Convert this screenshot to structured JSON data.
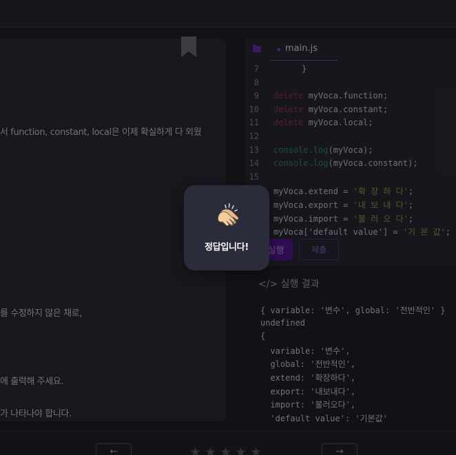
{
  "editor": {
    "tab_name": "main.js",
    "lines": [
      {
        "num": "7",
        "parts": [
          {
            "t": "}",
            "c": "src"
          }
        ]
      },
      {
        "num": "8",
        "parts": []
      },
      {
        "num": "9",
        "parts": [
          {
            "t": "delete",
            "c": "kw"
          },
          {
            "t": " myVoca.function;",
            "c": ""
          }
        ]
      },
      {
        "num": "10",
        "parts": [
          {
            "t": "delete",
            "c": "kw"
          },
          {
            "t": " myVoca.constant;",
            "c": ""
          }
        ]
      },
      {
        "num": "11",
        "parts": [
          {
            "t": "delete",
            "c": "kw"
          },
          {
            "t": " myVoca.local;",
            "c": ""
          }
        ]
      },
      {
        "num": "12",
        "parts": []
      },
      {
        "num": "13",
        "parts": [
          {
            "t": "console.log",
            "c": "fn"
          },
          {
            "t": "(myVoca);",
            "c": ""
          }
        ]
      },
      {
        "num": "14",
        "parts": [
          {
            "t": "console.log",
            "c": "fn"
          },
          {
            "t": "(myVoca.constant);",
            "c": ""
          }
        ]
      },
      {
        "num": "15",
        "parts": []
      },
      {
        "num": "",
        "parts": [
          {
            "t": "myVoca.extend = ",
            "c": ""
          },
          {
            "t": "'확 장 하 다'",
            "c": "str"
          },
          {
            "t": ";",
            "c": ""
          }
        ]
      },
      {
        "num": "",
        "parts": [
          {
            "t": "myVoca.export = ",
            "c": ""
          },
          {
            "t": "'내 보 내 다'",
            "c": "str"
          },
          {
            "t": ";",
            "c": ""
          }
        ]
      },
      {
        "num": "",
        "parts": [
          {
            "t": "myVoca.import = ",
            "c": ""
          },
          {
            "t": "'불 러 오 다'",
            "c": "str"
          },
          {
            "t": ";",
            "c": ""
          }
        ]
      },
      {
        "num": "",
        "parts": [
          {
            "t": "myVoca['default value'] = ",
            "c": ""
          },
          {
            "t": "'기 본 값'",
            "c": "str"
          },
          {
            "t": ";",
            "c": ""
          }
        ]
      }
    ],
    "run_label": "실행",
    "submit_label": "제출"
  },
  "result": {
    "title": "</> 실행 결과",
    "lines": [
      "{ variable: '변수', global: '전반적인' }",
      "undefined",
      "{",
      "  variable: '변수',",
      "  global: '전반적인',",
      "  extend: '확장하다',",
      "  export: '내보내다',",
      "  import: '불러오다',",
      "  'default value': '기본값'"
    ]
  },
  "lesson": {
    "lines": [
      "서 function, constant, local은 이제 확실하게 다 외웠",
      "를 수정하지 않은 채로,",
      "에 출력해 주세요.",
      "가 나타나야 합니다."
    ]
  },
  "footer": {
    "prev_label": "←",
    "next_label": "→",
    "rating": 0,
    "rating_max": 5
  },
  "modal": {
    "icon": "clapping-hands-icon",
    "message": "정답입니다!"
  }
}
